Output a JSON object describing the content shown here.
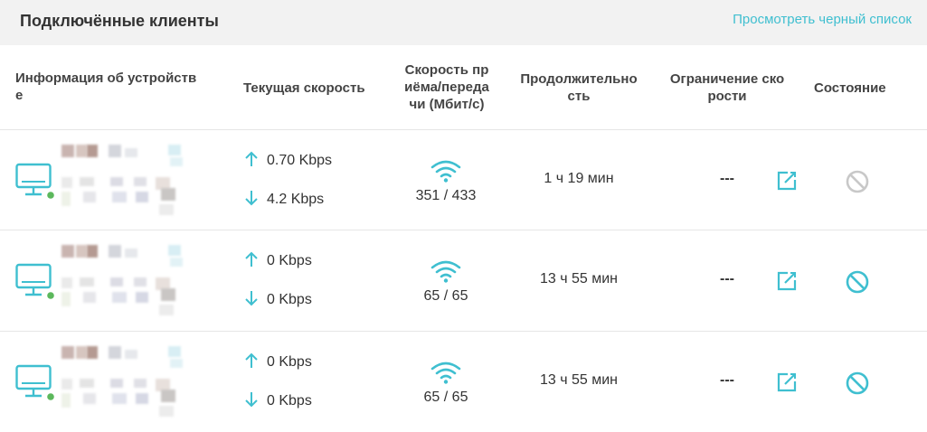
{
  "panel": {
    "title": "Подключённые клиенты",
    "blacklist_link": "Просмотреть черный список"
  },
  "columns": {
    "device_info": [
      "Информация об устройств",
      "е"
    ],
    "current_speed": "Текущая скорость",
    "rx_tx_speed": [
      "Скорость пр",
      "иёма/переда",
      "чи (Мбит/с)"
    ],
    "duration": [
      "Продолжительно",
      "сть"
    ],
    "speed_limit": [
      "Ограничение ско",
      "рости"
    ],
    "status": "Состояние"
  },
  "colors": {
    "accent": "#3fbfd0",
    "online_dot": "#5cb85c",
    "disabled_block": "#c8c8c8"
  },
  "clients": [
    {
      "device_icon": "computer-icon",
      "online": true,
      "upload": "0.70 Kbps",
      "download": "4.2 Kbps",
      "link_speed": "351 / 433",
      "duration": "1 ч 19 мин",
      "limit": "---",
      "block_enabled": false
    },
    {
      "device_icon": "computer-icon",
      "online": true,
      "upload": "0 Kbps",
      "download": "0 Kbps",
      "link_speed": "65 / 65",
      "duration": "13 ч 55 мин",
      "limit": "---",
      "block_enabled": true
    },
    {
      "device_icon": "computer-icon",
      "online": true,
      "upload": "0 Kbps",
      "download": "0 Kbps",
      "link_speed": "65 / 65",
      "duration": "13 ч 55 мин",
      "limit": "---",
      "block_enabled": true
    }
  ]
}
